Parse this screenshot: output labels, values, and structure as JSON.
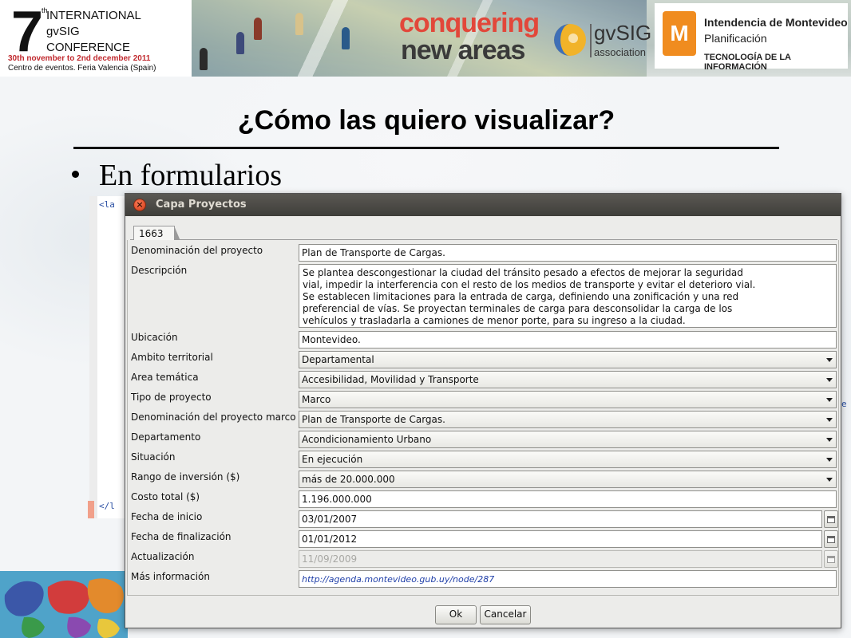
{
  "banner": {
    "conference": {
      "number": "7",
      "ordinal": "th",
      "line1": "INTERNATIONAL",
      "line2": "gvSIG",
      "line3": "CONFERENCE",
      "dates": "30th november to 2nd december 2011",
      "venue": "Centro de eventos. Feria Valencia (Spain)"
    },
    "slogan": {
      "line1": "conquering",
      "line2": "new areas"
    },
    "gvsig": {
      "name": "gvSIG",
      "subtitle": "association"
    },
    "intendencia": {
      "name": "Intendencia de Montevideo",
      "department": "Planificación",
      "unit": "TECNOLOGÍA DE LA INFORMACIÓN"
    }
  },
  "slide": {
    "title": "¿Cómo las quiero visualizar?",
    "bullet": "En formularios"
  },
  "editor": {
    "open_tag": "<la",
    "close_tag": "</l",
    "right_mark": "e"
  },
  "dialog": {
    "title": "Capa Proyectos",
    "tab": "1663",
    "fields": {
      "denominacion": {
        "label": "Denominación del proyecto",
        "value": "Plan de Transporte de Cargas."
      },
      "descripcion": {
        "label": "Descripción",
        "lines": [
          "Se plantea descongestionar la ciudad del tránsito pesado a efectos de mejorar la seguridad",
          "vial, impedir la interferencia con el resto de los medios de transporte y evitar el deterioro vial.",
          "Se establecen limitaciones para la entrada de carga, definiendo una zonificación y una red",
          "preferencial de vías. Se proyectan terminales de carga para desconsolidar la carga de los",
          "vehículos y trasladarla a camiones de menor porte, para su ingreso a la ciudad."
        ]
      },
      "ubicacion": {
        "label": "Ubicación",
        "value": "Montevideo."
      },
      "ambito": {
        "label": "Ambito territorial",
        "value": "Departamental"
      },
      "area": {
        "label": "Area temática",
        "value": "Accesibilidad, Movilidad y Transporte"
      },
      "tipo": {
        "label": "Tipo de proyecto",
        "value": "Marco"
      },
      "marco": {
        "label": "Denominación del proyecto marco",
        "value": "Plan de Transporte de Cargas."
      },
      "departamento": {
        "label": "Departamento",
        "value": "Acondicionamiento Urbano"
      },
      "situacion": {
        "label": "Situación",
        "value": "En ejecución"
      },
      "rango": {
        "label": "Rango de inversión ($)",
        "value": "más de 20.000.000"
      },
      "costo": {
        "label": "Costo total ($)",
        "value": "1.196.000.000"
      },
      "inicio": {
        "label": "Fecha de inicio",
        "value": "03/01/2007"
      },
      "fin": {
        "label": "Fecha de finalización",
        "value": "01/01/2012"
      },
      "actualizacion": {
        "label": "Actualización",
        "value": "11/09/2009"
      },
      "info": {
        "label": "Más información",
        "value": "http://agenda.montevideo.gub.uy/node/287"
      }
    },
    "buttons": {
      "ok": "Ok",
      "cancel": "Cancelar"
    }
  },
  "colors": {
    "accent_red": "#e2473a",
    "titlebar": "#3f3e3a",
    "link": "#1f3fa8",
    "imm_orange": "#f08c1f"
  }
}
